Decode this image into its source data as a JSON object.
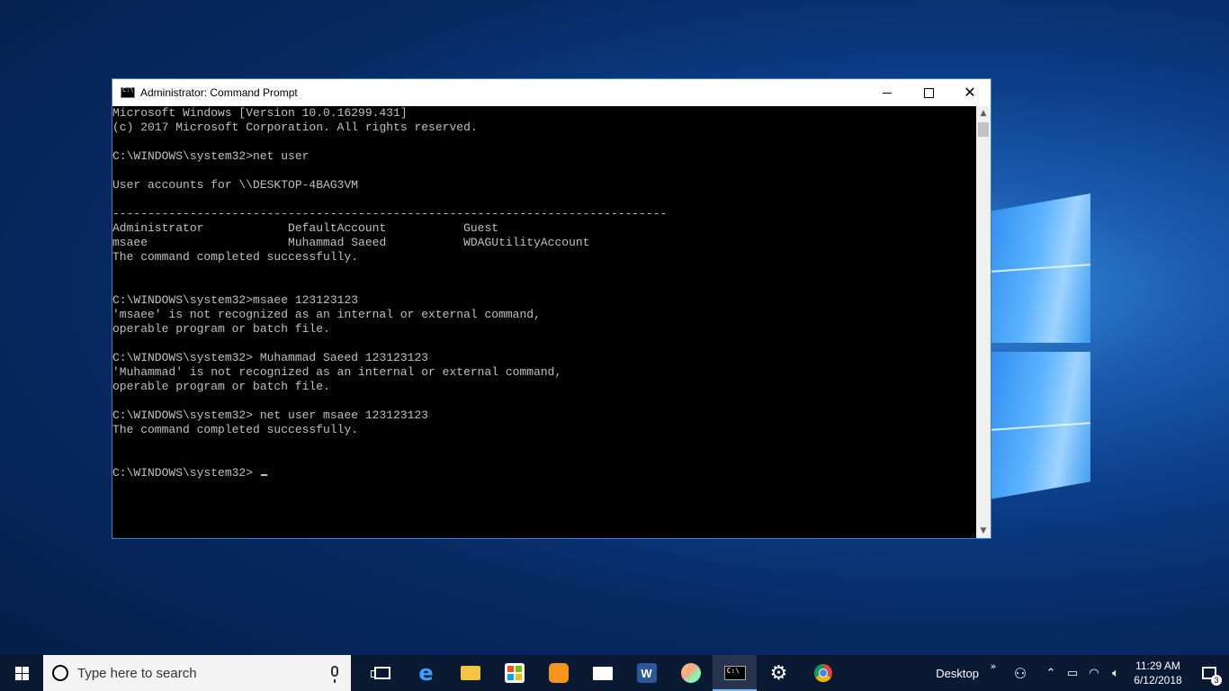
{
  "window": {
    "title": "Administrator: Command Prompt"
  },
  "console": {
    "lines": [
      "Microsoft Windows [Version 10.0.16299.431]",
      "(c) 2017 Microsoft Corporation. All rights reserved.",
      "",
      "C:\\WINDOWS\\system32>net user",
      "",
      "User accounts for \\\\DESKTOP-4BAG3VM",
      "",
      "-------------------------------------------------------------------------------",
      "Administrator            DefaultAccount           Guest",
      "msaee                    Muhammad Saeed           WDAGUtilityAccount",
      "The command completed successfully.",
      "",
      "",
      "C:\\WINDOWS\\system32>msaee 123123123",
      "'msaee' is not recognized as an internal or external command,",
      "operable program or batch file.",
      "",
      "C:\\WINDOWS\\system32> Muhammad Saeed 123123123",
      "'Muhammad' is not recognized as an internal or external command,",
      "operable program or batch file.",
      "",
      "C:\\WINDOWS\\system32> net user msaee 123123123",
      "The command completed successfully.",
      "",
      "",
      "C:\\WINDOWS\\system32> "
    ]
  },
  "taskbar": {
    "search_placeholder": "Type here to search",
    "apps": [
      {
        "name": "task-view-icon",
        "active": false
      },
      {
        "name": "edge-icon",
        "active": false
      },
      {
        "name": "file-explorer-icon",
        "active": false
      },
      {
        "name": "store-icon",
        "active": false
      },
      {
        "name": "uc-browser-icon",
        "active": false
      },
      {
        "name": "mail-icon",
        "active": false
      },
      {
        "name": "word-icon",
        "label": "W",
        "active": false
      },
      {
        "name": "paint-icon",
        "active": false
      },
      {
        "name": "command-prompt-icon",
        "active": true
      },
      {
        "name": "settings-icon",
        "active": false
      },
      {
        "name": "chrome-icon",
        "active": false
      }
    ],
    "tray": {
      "desktop_label": "Desktop",
      "time": "11:29 AM",
      "date": "6/12/2018",
      "notification_count": "3"
    }
  }
}
